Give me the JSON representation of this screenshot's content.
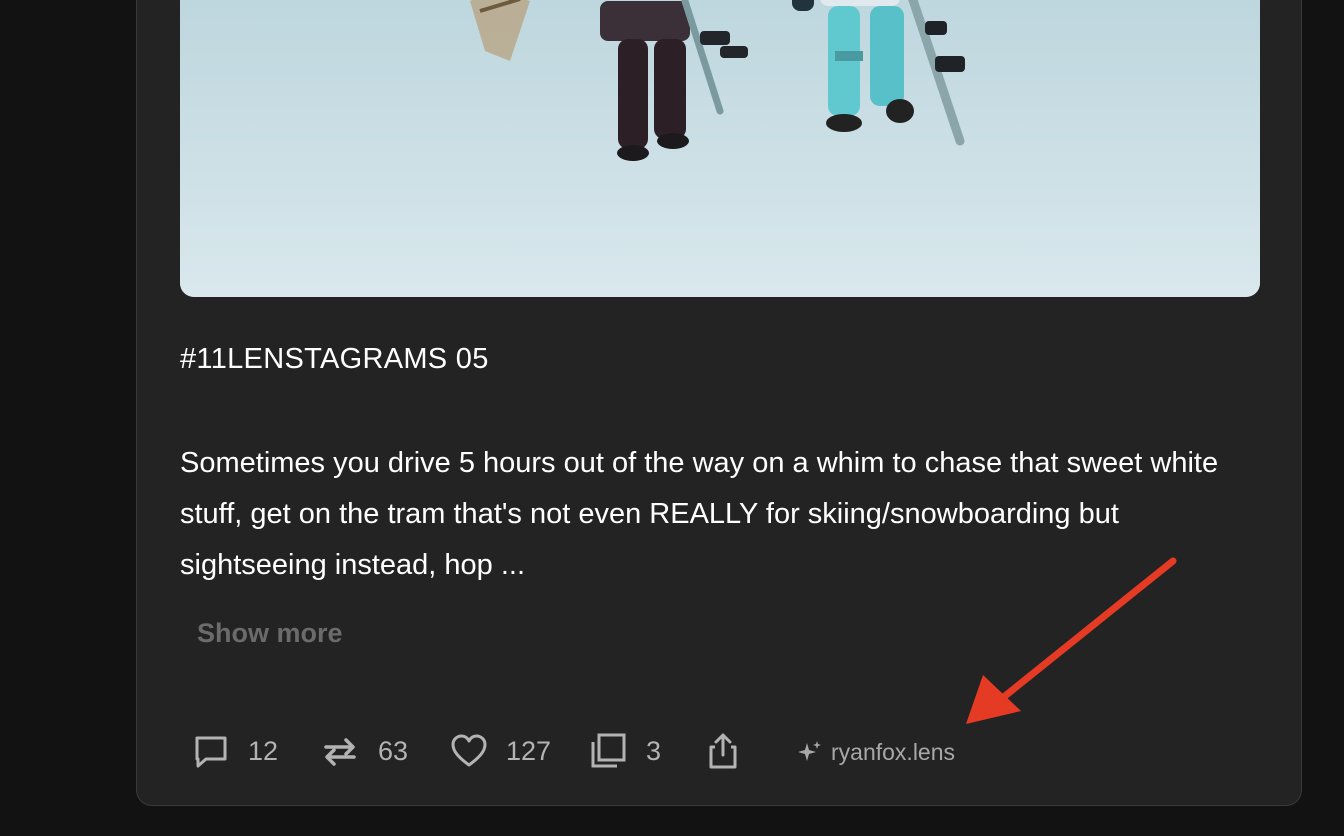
{
  "post": {
    "title": "#11LENSTAGRAMS 05",
    "body": "Sometimes you drive 5 hours out of the way on a whim to chase that sweet white stuff, get on the tram that's not even REALLY for skiing/snowboarding but sightseeing instead, hop ...",
    "show_more_label": "Show more"
  },
  "actions": {
    "comments": "12",
    "reposts": "63",
    "likes": "127",
    "quotes": "3"
  },
  "credit": {
    "icon": "sparkle-icon",
    "username": "ryanfox.lens"
  },
  "colors": {
    "background": "#121212",
    "card": "#232323",
    "annotation_arrow": "#e53a24"
  }
}
